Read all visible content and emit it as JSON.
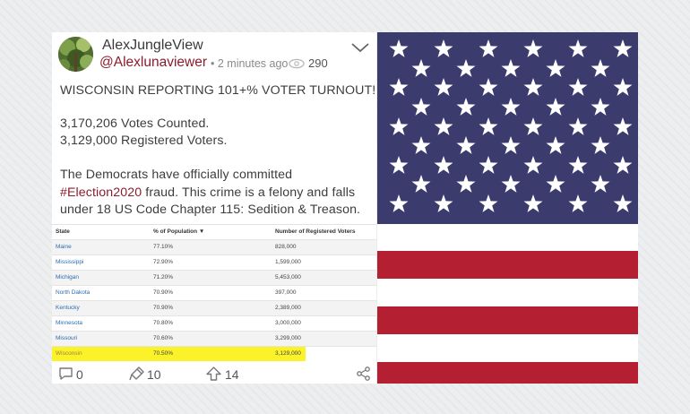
{
  "post": {
    "author_name": "AlexJungleView",
    "handle": "@Alexlunaviewer",
    "time_label": "2 minutes ago",
    "views": "290",
    "headline": "WISCONSIN REPORTING 101+% VOTER TURNOUT!",
    "votes_counted": "3,170,206 Votes Counted.",
    "registered_voters": "3,129,000 Registered Voters.",
    "body_line1": "The Democrats have officially committed",
    "hashtag": "#Election2020",
    "body_line2_rest": " fraud. This crime is a felony and falls",
    "body_line3": "under 18 US Code Chapter 115: Sedition & Treason."
  },
  "table": {
    "headers": [
      "State",
      "% of Population",
      "Number of Registered Voters"
    ],
    "rows": [
      {
        "state": "Maine",
        "pct": "77.10%",
        "voters": "828,000"
      },
      {
        "state": "Mississippi",
        "pct": "72.90%",
        "voters": "1,599,000"
      },
      {
        "state": "Michigan",
        "pct": "71.20%",
        "voters": "5,453,000"
      },
      {
        "state": "North Dakota",
        "pct": "70.90%",
        "voters": "397,000"
      },
      {
        "state": "Kentucky",
        "pct": "70.90%",
        "voters": "2,389,000"
      },
      {
        "state": "Minnesota",
        "pct": "70.80%",
        "voters": "3,000,000"
      },
      {
        "state": "Missouri",
        "pct": "70.60%",
        "voters": "3,299,000"
      },
      {
        "state": "Wisconsin",
        "pct": "70.50%",
        "voters": "3,129,000",
        "highlighted": true
      }
    ],
    "sort_indicator": "▼",
    "highlight_color": "#fbf22a"
  },
  "footer": {
    "comments": "0",
    "reposts": "10",
    "upvotes": "14",
    "icons": [
      "comment-icon",
      "repost-icon",
      "upvote-icon",
      "share-icon"
    ]
  },
  "flag": {
    "icon": "us-flag",
    "red": "#b42032",
    "blue": "#3c3b6e",
    "white": "#ffffff"
  },
  "colors": {
    "handle": "#8b1c2c",
    "link": "#2a6db0"
  }
}
